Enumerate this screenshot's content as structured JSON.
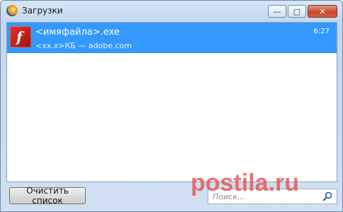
{
  "window": {
    "title": "Загрузки",
    "controls": {
      "minimize": "—",
      "maximize": "▢",
      "close": "✕"
    }
  },
  "downloads": [
    {
      "file_name": "<имяфайла>.exe",
      "meta": "<xx.x>КБ — adobe.com",
      "time": "6:27",
      "icon": "flash-player-icon",
      "selected": true
    }
  ],
  "bottom": {
    "clear_label": "Очистить список",
    "search_placeholder": "Поиск..."
  },
  "watermark": {
    "text": "postila.ru",
    "color": "#e84b4b"
  },
  "colors": {
    "selection": "#3399ff",
    "close_button": "#c74a2f"
  }
}
